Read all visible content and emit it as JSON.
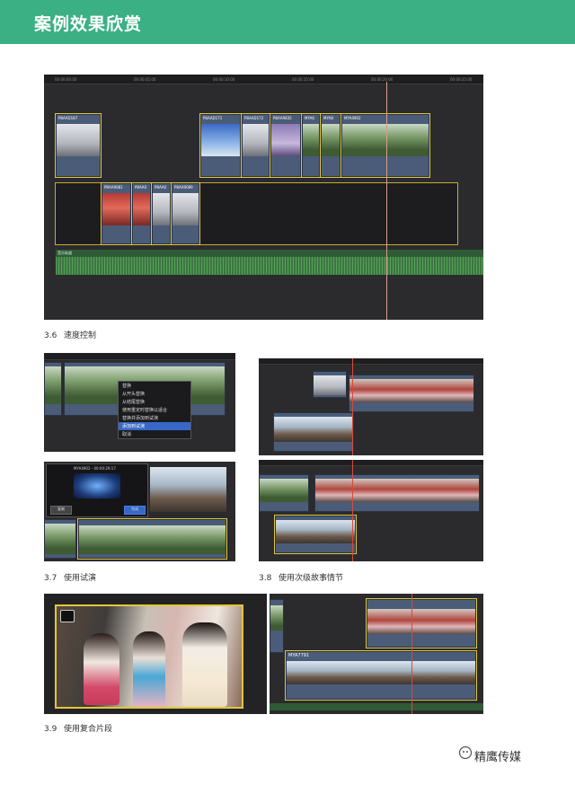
{
  "header": {
    "title": "案例效果欣赏"
  },
  "figures": [
    {
      "id": "fig1",
      "number": "3.6",
      "caption": "速度控制",
      "clip_labels": [
        "P8AAD187",
        "P8AAD171",
        "P8AAD172",
        "P8AA9835",
        "MYA6",
        "MYA8",
        "MYA4902",
        "P8AA9081",
        "P8AA0",
        "P8AA0",
        "P8AA0",
        "P8AA9089"
      ],
      "audio_label": "音乐轨道"
    },
    {
      "id": "fig2",
      "number": "3.7",
      "caption": "使用试演",
      "menu_items": [
        "替换",
        "从开头替换",
        "从结尾替换",
        "使用重定时替换以适合",
        "替换并添加到试演",
        "添加到试演",
        "取消"
      ],
      "audition_title": "MYA4902 - 00:00:29:17",
      "audition_buttons": [
        "复制",
        "完成"
      ]
    },
    {
      "id": "fig3",
      "number": "3.8",
      "caption": "使用次级故事情节"
    },
    {
      "id": "fig4",
      "number": "3.9",
      "caption": "使用复合片段",
      "clip_label": "MYA7791"
    }
  ],
  "watermark": {
    "text": "精鹰传媒"
  }
}
